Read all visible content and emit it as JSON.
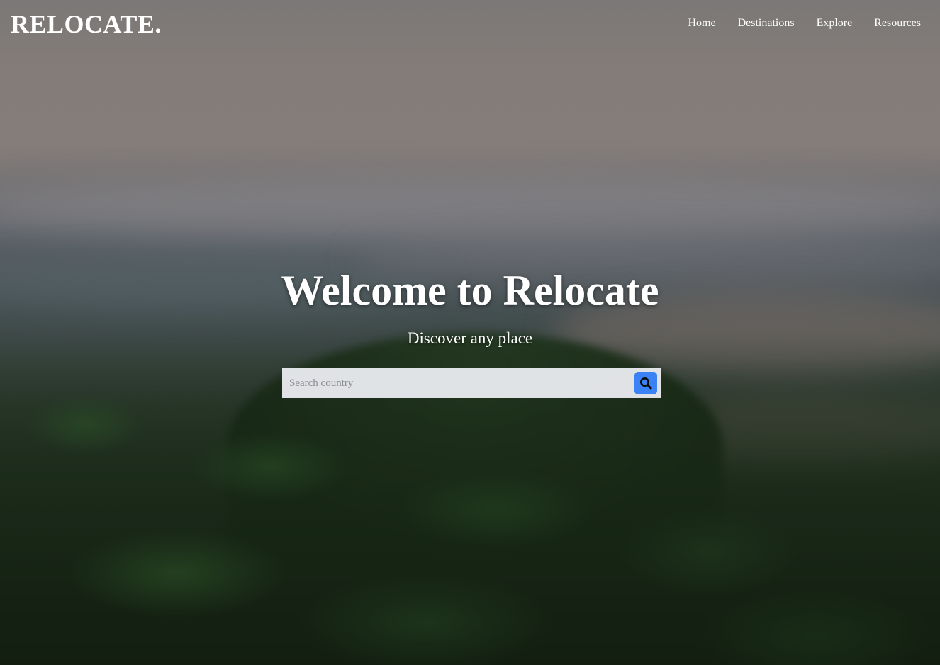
{
  "brand": {
    "logo_text": "RELOCATE."
  },
  "nav": {
    "items": [
      {
        "label": "Home"
      },
      {
        "label": "Destinations"
      },
      {
        "label": "Explore"
      },
      {
        "label": "Resources"
      }
    ]
  },
  "hero": {
    "title": "Welcome to Relocate",
    "subtitle": "Discover any place"
  },
  "search": {
    "placeholder": "Search country",
    "value": "",
    "button_icon": "search-icon",
    "button_color": "#3b82f6"
  }
}
